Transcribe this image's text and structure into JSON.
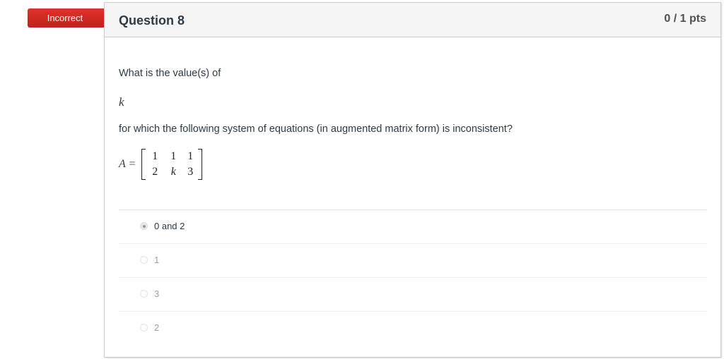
{
  "status_badge": "Incorrect",
  "question": {
    "title": "Question 8",
    "points": "0 / 1 pts",
    "text_line1": "What is the value(s) of",
    "variable": "k",
    "text_line2": "for which the following system of equations (in augmented matrix form) is inconsistent?",
    "matrix": {
      "label": "A =",
      "rows": [
        [
          "1",
          "1",
          "1"
        ],
        [
          "2",
          "k",
          "3"
        ]
      ]
    }
  },
  "answers": [
    {
      "label": "0 and 2",
      "selected": true
    },
    {
      "label": "1",
      "selected": false
    },
    {
      "label": "3",
      "selected": false
    },
    {
      "label": "2",
      "selected": false
    }
  ],
  "colors": {
    "incorrect_badge": "#d52b25",
    "header_bg": "#f5f5f5",
    "border": "#c7cdd1"
  }
}
